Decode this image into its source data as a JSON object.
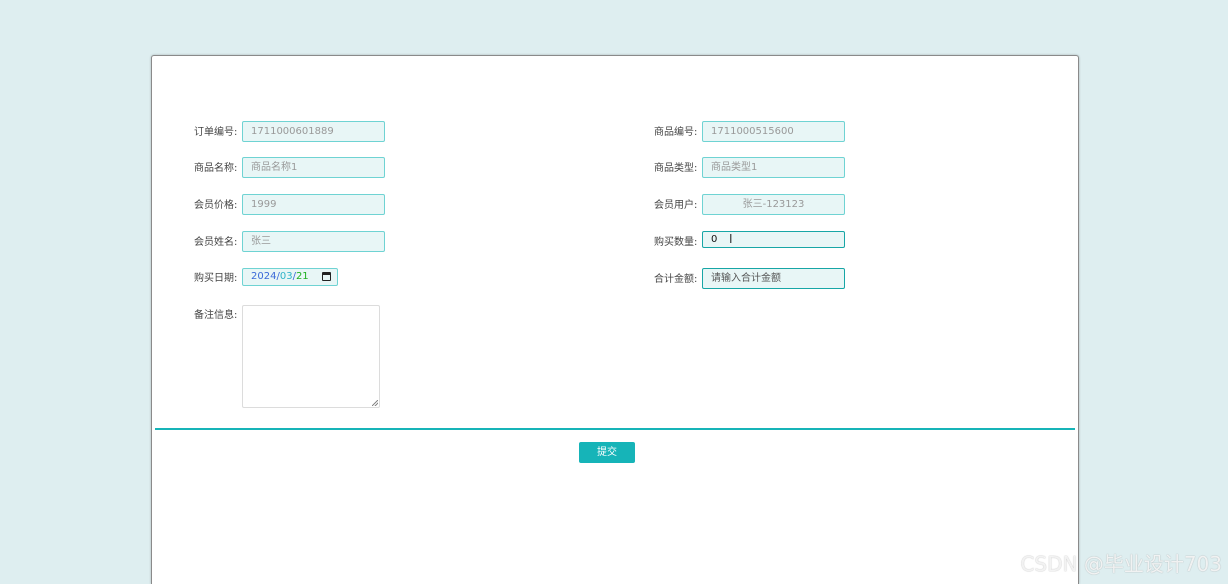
{
  "form": {
    "left": [
      {
        "label": "订单编号:",
        "value": "1711000601889"
      },
      {
        "label": "商品名称:",
        "value": "商品名称1"
      },
      {
        "label": "会员价格:",
        "value": "1999"
      },
      {
        "label": "会员姓名:",
        "value": "张三"
      },
      {
        "label": "购买日期:",
        "date": {
          "year": "2024",
          "sep1": "/",
          "month": "03",
          "sep2": "/",
          "day": "21"
        }
      },
      {
        "label": "备注信息:",
        "value": ""
      }
    ],
    "right": [
      {
        "label": "商品编号:",
        "value": "1711000515600"
      },
      {
        "label": "商品类型:",
        "value": "商品类型1"
      },
      {
        "label": "会员用户:",
        "value": "张三-123123"
      },
      {
        "label": "购买数量:",
        "value": "0"
      },
      {
        "label": "合计金额:",
        "placeholder": "请输入合计金额"
      }
    ],
    "submit_label": "提交"
  },
  "cursor_glyph": "I",
  "watermark": "CSDN @毕业设计703",
  "colors": {
    "page_bg": "#deeef0",
    "accent": "#16b4b8",
    "field_bg": "#e8f6f6",
    "field_border": "#6fd3d3"
  },
  "icons": {
    "date_picker": "calendar-icon",
    "textarea_resize": "resize-grip-icon"
  }
}
